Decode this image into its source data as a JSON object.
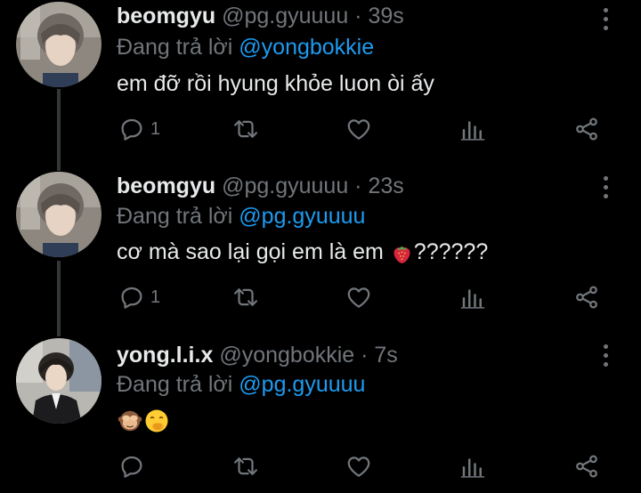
{
  "tweets": [
    {
      "name": "beomgyu",
      "handle": "@pg.gyuuuu",
      "sep": " · ",
      "time": "39s",
      "reply_prefix": "Đang trả lời ",
      "reply_to": "@yongbokkie",
      "text": "em đỡ rồi hyung khỏe luon òi ấy",
      "reply_count": "1"
    },
    {
      "name": "beomgyu",
      "handle": "@pg.gyuuuu",
      "sep": " · ",
      "time": "23s",
      "reply_prefix": "Đang trả lời ",
      "reply_to": "@pg.gyuuuu",
      "text_before": "cơ mà sao lại gọi em là em ",
      "text_emoji": "strawberry",
      "text_after": "??????",
      "reply_count": "1"
    },
    {
      "name": "yong.l.i.x",
      "handle": "@yongbokkie",
      "sep": " · ",
      "time": "7s",
      "reply_prefix": "Đang trả lời ",
      "reply_to": "@pg.gyuuuu",
      "text_emojis": [
        "see-no-evil-monkey",
        "face-with-hand-over-mouth"
      ],
      "reply_count": ""
    }
  ],
  "colors": {
    "background": "#000000",
    "text": "#e7e9ea",
    "secondary": "#71767b",
    "mention": "#1d9bf0",
    "thread_line": "#333639"
  },
  "icons": [
    "reply-icon",
    "retweet-icon",
    "like-icon",
    "analytics-icon",
    "share-icon",
    "more-icon"
  ]
}
